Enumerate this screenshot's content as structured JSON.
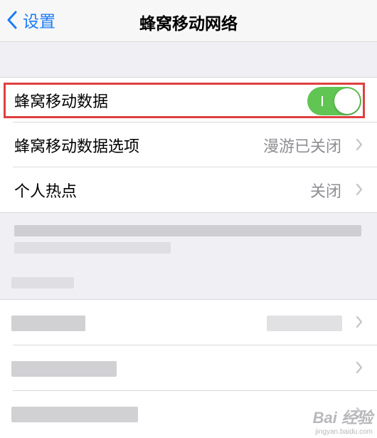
{
  "navbar": {
    "back_label": "设置",
    "title": "蜂窝移动网络"
  },
  "settings": {
    "cellular_data": {
      "label": "蜂窝移动数据",
      "enabled": true
    },
    "cellular_options": {
      "label": "蜂窝移动数据选项",
      "value": "漫游已关闭"
    },
    "hotspot": {
      "label": "个人热点",
      "value": "关闭"
    }
  },
  "colors": {
    "accent": "#1c7cf4",
    "toggle_on": "#61c554",
    "highlight": "#e04040"
  },
  "watermark": {
    "text": "Bai 经验",
    "url": "jingyan.baidu.com"
  }
}
